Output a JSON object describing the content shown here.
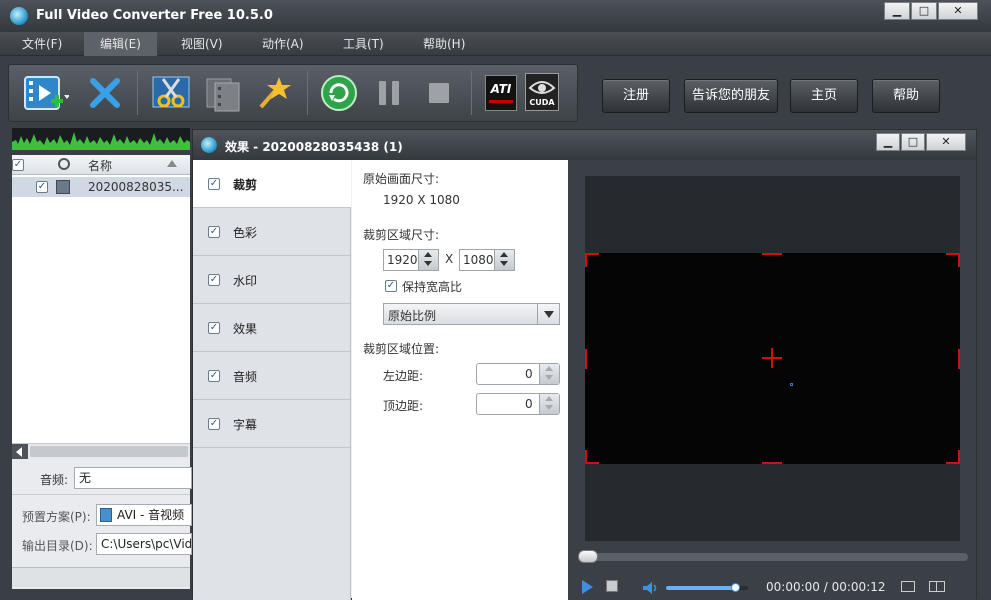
{
  "app": {
    "title": "Full Video Converter Free 10.5.0"
  },
  "window_buttons": {
    "minimize": "▁",
    "maximize": "□",
    "close": "✕"
  },
  "menu": [
    "文件(F)",
    "编辑(E)",
    "视图(V)",
    "动作(A)",
    "工具(T)",
    "帮助(H)"
  ],
  "menu_active_index": 1,
  "right_buttons": [
    "注册",
    "告诉您的朋友",
    "主页",
    "帮助"
  ],
  "toolbar_badges": {
    "ati": "ATI",
    "cuda": "CUDA"
  },
  "file_list": {
    "header_name": "名称",
    "rows": [
      {
        "name": "20200828035..."
      }
    ]
  },
  "left_bottom": {
    "audio_label": "音频:",
    "audio_value": "无",
    "preset_label": "预置方案(P):",
    "preset_value": "AVI - 音视频",
    "output_label": "输出目录(D):",
    "output_value": "C:\\Users\\pc\\Vid"
  },
  "dialog": {
    "title": "效果 - 20200828035438 (1)",
    "side_items": [
      "裁剪",
      "色彩",
      "水印",
      "效果",
      "音频",
      "字幕"
    ],
    "side_active_index": 0,
    "form": {
      "orig_size_label": "原始画面尺寸:",
      "orig_size_value": "1920 X 1080",
      "crop_size_label": "裁剪区域尺寸:",
      "crop_width": "1920",
      "crop_x": "X",
      "crop_height": "1080",
      "keep_ratio_label": "保持宽高比",
      "ratio_option": "原始比例",
      "crop_pos_label": "裁剪区域位置:",
      "left_margin_label": "左边距:",
      "left_margin_value": "0",
      "top_margin_label": "顶边距:",
      "top_margin_value": "0"
    },
    "player": {
      "time_current": "00:00:00",
      "time_sep": "/",
      "time_total": "00:00:12",
      "volume_level": 0.85,
      "seek_position": 0.0
    }
  },
  "colors": {
    "accent_red": "#d01010",
    "accent_blue": "#1d8fc4",
    "waveform_green": "#3fbf3f"
  }
}
